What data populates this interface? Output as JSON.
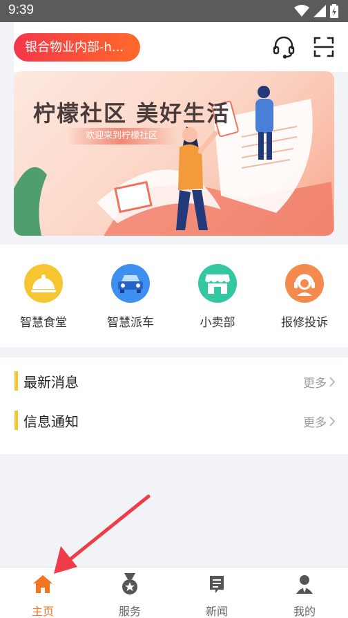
{
  "status_bar": {
    "time": "9:39"
  },
  "header": {
    "location": "银合物业内部-h...",
    "support_icon": "headset-icon",
    "scan_icon": "scan-icon"
  },
  "banner": {
    "title": "柠檬社区 美好生活",
    "subtitle": "欢迎来到柠檬社区"
  },
  "quick_actions": [
    {
      "label": "智慧食堂",
      "icon": "cloche-icon",
      "color": "#f6c531"
    },
    {
      "label": "智慧派车",
      "icon": "car-icon",
      "color": "#3d8ff0"
    },
    {
      "label": "小卖部",
      "icon": "shop-icon",
      "color": "#34c7a2"
    },
    {
      "label": "报修投诉",
      "icon": "customer-service-icon",
      "color": "#f58a4e"
    }
  ],
  "news": {
    "items": [
      {
        "title": "最新消息",
        "more": "更多"
      },
      {
        "title": "信息通知",
        "more": "更多"
      }
    ]
  },
  "tabs": [
    {
      "label": "主页",
      "icon": "home-icon",
      "active": true
    },
    {
      "label": "服务",
      "icon": "medal-icon",
      "active": false
    },
    {
      "label": "新闻",
      "icon": "news-icon",
      "active": false
    },
    {
      "label": "我的",
      "icon": "person-icon",
      "active": false
    }
  ],
  "colors": {
    "accent": "#f5741f",
    "pill_start": "#f5364a",
    "pill_end": "#ff6a2a",
    "highlight_bar": "#f6c531",
    "arrow": "#ef3c48"
  }
}
